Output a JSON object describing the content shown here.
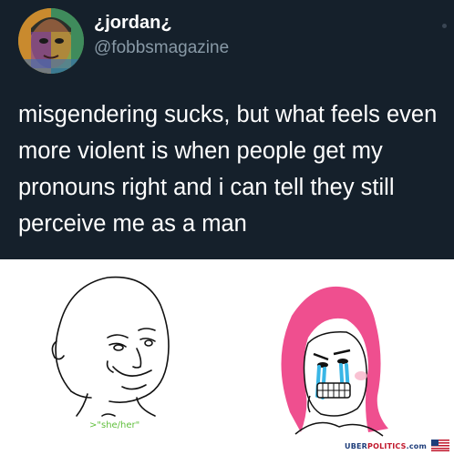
{
  "tweet": {
    "display_name": "¿jordan¿",
    "handle": "@fobbsmagazine",
    "text": "misgendering sucks, but what feels even more violent is when people get my pronouns right and i can tell they still perceive me as a man"
  },
  "meme": {
    "caption": ">\"she/her\"",
    "watermark_prefix": "UBER",
    "watermark_main": "POLITICS",
    "watermark_suffix": ".com"
  },
  "colors": {
    "tweet_background": "#15202b",
    "handle_gray": "#8899a6",
    "caption_green": "#5fbf3b",
    "hair_pink": "#ef4f8f",
    "tears_blue": "#39b6e6"
  },
  "icons": [
    "avatar-image",
    "wojak-drawing",
    "crying-pink-hair-drawing",
    "us-flag-icon"
  ]
}
